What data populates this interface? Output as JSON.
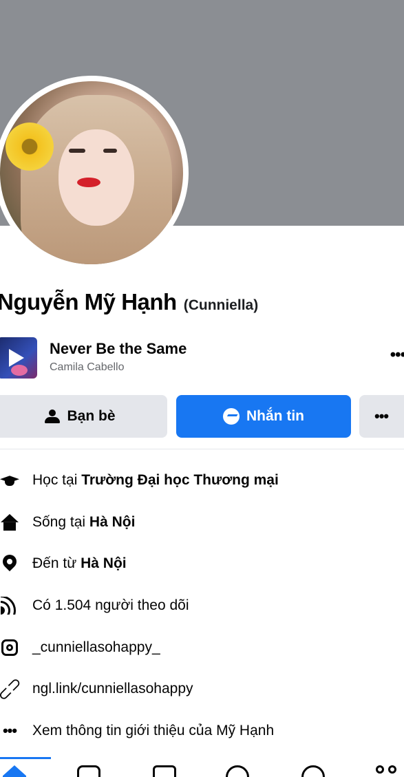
{
  "profile": {
    "name": "Nguyễn Mỹ Hạnh",
    "alternate_name": "(Cunniella)"
  },
  "music": {
    "song_title": "Never Be the Same",
    "artist": "Camila Cabello",
    "more_label": "•••"
  },
  "actions": {
    "friends_label": "Bạn bè",
    "message_label": "Nhắn tin",
    "more_label": "•••"
  },
  "intro": {
    "items": [
      {
        "icon": "graduation-cap-icon",
        "prefix": "Học tại ",
        "value": "Trường Đại học Thương mại"
      },
      {
        "icon": "home-icon",
        "prefix": "Sống tại ",
        "value": "Hà Nội"
      },
      {
        "icon": "location-pin-icon",
        "prefix": "Đến từ ",
        "value": "Hà Nội"
      },
      {
        "icon": "followers-icon",
        "prefix": "Có ",
        "value": "1.504 người theo dõi"
      },
      {
        "icon": "instagram-icon",
        "prefix": "",
        "value": "_cunniellasohappy_"
      },
      {
        "icon": "link-icon",
        "prefix": "",
        "value": "ngl.link/cunniellasohappy"
      },
      {
        "icon": "more-dots-icon",
        "prefix": "",
        "value": "Xem thông tin giới thiệu của Mỹ Hạnh"
      }
    ]
  },
  "colors": {
    "accent": "#1877f2",
    "cover": "#8b8e93",
    "secondary_button": "#e4e6eb"
  },
  "tabbar": {
    "tabs": [
      "home-icon",
      "video-icon",
      "marketplace-icon",
      "groups-icon",
      "notifications-icon",
      "menu-icon"
    ],
    "active": "home-icon"
  }
}
